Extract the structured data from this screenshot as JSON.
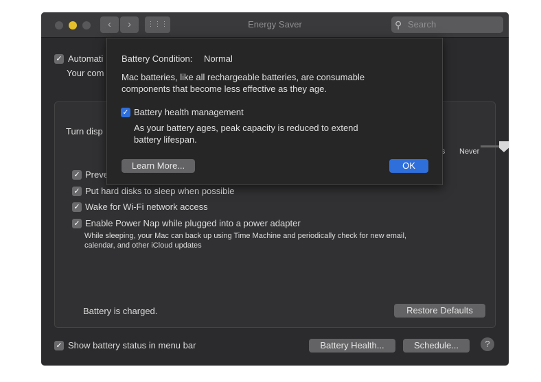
{
  "window": {
    "title": "Energy Saver",
    "search_placeholder": "Search",
    "back": "‹",
    "forward": "›",
    "grid": "⋮⋮⋮"
  },
  "background": {
    "auto_switch_label": "Automati",
    "auto_switch_sub": "Your com",
    "turn_display_label": "Turn disp",
    "slider": {
      "labels": [
        "hrs",
        "Never"
      ],
      "value": "Never"
    },
    "options": [
      {
        "label": "Preve",
        "checked": true
      },
      {
        "label": "Put hard disks to sleep when possible",
        "checked": true
      },
      {
        "label": "Wake for Wi-Fi network access",
        "checked": true
      },
      {
        "label": "Enable Power Nap while plugged into a power adapter",
        "checked": true
      }
    ],
    "power_nap_desc_1": "While sleeping, your Mac can back up using Time Machine and periodically check for new email,",
    "power_nap_desc_2": "calendar, and other iCloud updates",
    "battery_status": "Battery is charged.",
    "restore_defaults": "Restore Defaults",
    "show_status_label": "Show battery status in menu bar",
    "battery_health_button": "Battery Health...",
    "schedule_button": "Schedule...",
    "help": "?"
  },
  "dialog": {
    "condition_label": "Battery Condition:",
    "condition_value": "Normal",
    "desc_1": "Mac batteries, like all rechargeable batteries, are consumable",
    "desc_2": "components that become less effective as they age.",
    "health_mgmt_label": "Battery health management",
    "health_mgmt_checked": true,
    "health_desc_1": "As your battery ages, peak capacity is reduced to extend",
    "health_desc_2": "battery lifespan.",
    "learn_more": "Learn More...",
    "ok": "OK"
  },
  "colors": {
    "accent": "#2f6fdc",
    "close_yellow": "#e6c02c"
  }
}
